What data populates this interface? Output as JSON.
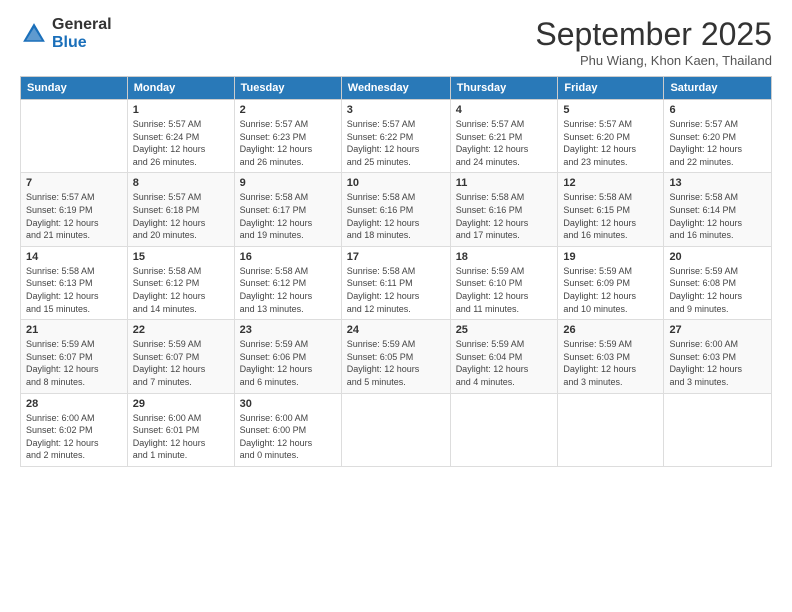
{
  "logo": {
    "general": "General",
    "blue": "Blue"
  },
  "title": "September 2025",
  "subtitle": "Phu Wiang, Khon Kaen, Thailand",
  "days_of_week": [
    "Sunday",
    "Monday",
    "Tuesday",
    "Wednesday",
    "Thursday",
    "Friday",
    "Saturday"
  ],
  "weeks": [
    [
      {
        "num": "",
        "detail": ""
      },
      {
        "num": "1",
        "detail": "Sunrise: 5:57 AM\nSunset: 6:24 PM\nDaylight: 12 hours\nand 26 minutes."
      },
      {
        "num": "2",
        "detail": "Sunrise: 5:57 AM\nSunset: 6:23 PM\nDaylight: 12 hours\nand 26 minutes."
      },
      {
        "num": "3",
        "detail": "Sunrise: 5:57 AM\nSunset: 6:22 PM\nDaylight: 12 hours\nand 25 minutes."
      },
      {
        "num": "4",
        "detail": "Sunrise: 5:57 AM\nSunset: 6:21 PM\nDaylight: 12 hours\nand 24 minutes."
      },
      {
        "num": "5",
        "detail": "Sunrise: 5:57 AM\nSunset: 6:20 PM\nDaylight: 12 hours\nand 23 minutes."
      },
      {
        "num": "6",
        "detail": "Sunrise: 5:57 AM\nSunset: 6:20 PM\nDaylight: 12 hours\nand 22 minutes."
      }
    ],
    [
      {
        "num": "7",
        "detail": "Sunrise: 5:57 AM\nSunset: 6:19 PM\nDaylight: 12 hours\nand 21 minutes."
      },
      {
        "num": "8",
        "detail": "Sunrise: 5:57 AM\nSunset: 6:18 PM\nDaylight: 12 hours\nand 20 minutes."
      },
      {
        "num": "9",
        "detail": "Sunrise: 5:58 AM\nSunset: 6:17 PM\nDaylight: 12 hours\nand 19 minutes."
      },
      {
        "num": "10",
        "detail": "Sunrise: 5:58 AM\nSunset: 6:16 PM\nDaylight: 12 hours\nand 18 minutes."
      },
      {
        "num": "11",
        "detail": "Sunrise: 5:58 AM\nSunset: 6:16 PM\nDaylight: 12 hours\nand 17 minutes."
      },
      {
        "num": "12",
        "detail": "Sunrise: 5:58 AM\nSunset: 6:15 PM\nDaylight: 12 hours\nand 16 minutes."
      },
      {
        "num": "13",
        "detail": "Sunrise: 5:58 AM\nSunset: 6:14 PM\nDaylight: 12 hours\nand 16 minutes."
      }
    ],
    [
      {
        "num": "14",
        "detail": "Sunrise: 5:58 AM\nSunset: 6:13 PM\nDaylight: 12 hours\nand 15 minutes."
      },
      {
        "num": "15",
        "detail": "Sunrise: 5:58 AM\nSunset: 6:12 PM\nDaylight: 12 hours\nand 14 minutes."
      },
      {
        "num": "16",
        "detail": "Sunrise: 5:58 AM\nSunset: 6:12 PM\nDaylight: 12 hours\nand 13 minutes."
      },
      {
        "num": "17",
        "detail": "Sunrise: 5:58 AM\nSunset: 6:11 PM\nDaylight: 12 hours\nand 12 minutes."
      },
      {
        "num": "18",
        "detail": "Sunrise: 5:59 AM\nSunset: 6:10 PM\nDaylight: 12 hours\nand 11 minutes."
      },
      {
        "num": "19",
        "detail": "Sunrise: 5:59 AM\nSunset: 6:09 PM\nDaylight: 12 hours\nand 10 minutes."
      },
      {
        "num": "20",
        "detail": "Sunrise: 5:59 AM\nSunset: 6:08 PM\nDaylight: 12 hours\nand 9 minutes."
      }
    ],
    [
      {
        "num": "21",
        "detail": "Sunrise: 5:59 AM\nSunset: 6:07 PM\nDaylight: 12 hours\nand 8 minutes."
      },
      {
        "num": "22",
        "detail": "Sunrise: 5:59 AM\nSunset: 6:07 PM\nDaylight: 12 hours\nand 7 minutes."
      },
      {
        "num": "23",
        "detail": "Sunrise: 5:59 AM\nSunset: 6:06 PM\nDaylight: 12 hours\nand 6 minutes."
      },
      {
        "num": "24",
        "detail": "Sunrise: 5:59 AM\nSunset: 6:05 PM\nDaylight: 12 hours\nand 5 minutes."
      },
      {
        "num": "25",
        "detail": "Sunrise: 5:59 AM\nSunset: 6:04 PM\nDaylight: 12 hours\nand 4 minutes."
      },
      {
        "num": "26",
        "detail": "Sunrise: 5:59 AM\nSunset: 6:03 PM\nDaylight: 12 hours\nand 3 minutes."
      },
      {
        "num": "27",
        "detail": "Sunrise: 6:00 AM\nSunset: 6:03 PM\nDaylight: 12 hours\nand 3 minutes."
      }
    ],
    [
      {
        "num": "28",
        "detail": "Sunrise: 6:00 AM\nSunset: 6:02 PM\nDaylight: 12 hours\nand 2 minutes."
      },
      {
        "num": "29",
        "detail": "Sunrise: 6:00 AM\nSunset: 6:01 PM\nDaylight: 12 hours\nand 1 minute."
      },
      {
        "num": "30",
        "detail": "Sunrise: 6:00 AM\nSunset: 6:00 PM\nDaylight: 12 hours\nand 0 minutes."
      },
      {
        "num": "",
        "detail": ""
      },
      {
        "num": "",
        "detail": ""
      },
      {
        "num": "",
        "detail": ""
      },
      {
        "num": "",
        "detail": ""
      }
    ]
  ]
}
